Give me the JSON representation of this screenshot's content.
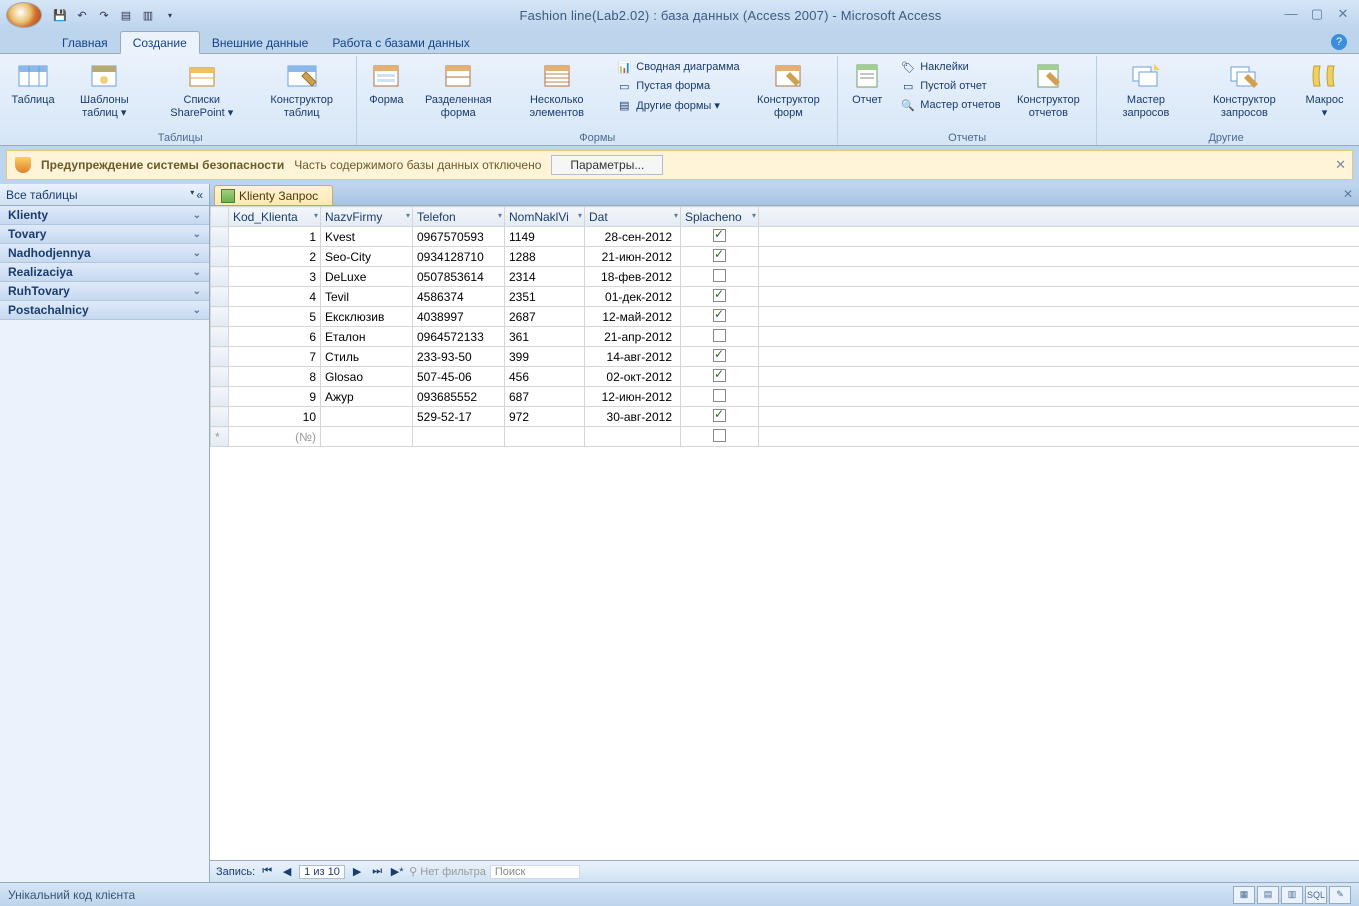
{
  "title": "Fashion line(Lab2.02) : база данных (Access 2007) - Microsoft Access",
  "tabs": [
    "Главная",
    "Создание",
    "Внешние данные",
    "Работа с базами данных"
  ],
  "active_tab": 1,
  "ribbon": {
    "groups": [
      {
        "label": "Таблицы",
        "buttons": [
          "Таблица",
          "Шаблоны таблиц ▾",
          "Списки SharePoint ▾",
          "Конструктор таблиц"
        ]
      },
      {
        "label": "Формы",
        "big": [
          "Форма",
          "Разделенная форма",
          "Несколько элементов"
        ],
        "small": [
          "Сводная диаграмма",
          "Пустая форма",
          "Другие формы ▾"
        ],
        "tail": [
          "Конструктор форм"
        ]
      },
      {
        "label": "Отчеты",
        "big": [
          "Отчет"
        ],
        "small": [
          "Наклейки",
          "Пустой отчет",
          "Мастер отчетов"
        ],
        "tail": [
          "Конструктор отчетов"
        ]
      },
      {
        "label": "Другие",
        "buttons": [
          "Мастер запросов",
          "Конструктор запросов",
          "Макрос ▾"
        ]
      }
    ]
  },
  "security": {
    "heading": "Предупреждение системы безопасности",
    "msg": "Часть содержимого базы данных отключено",
    "btn": "Параметры..."
  },
  "nav": {
    "header": "Все таблицы",
    "items": [
      "Klienty",
      "Tovary",
      "Nadhodjennya",
      "Realizaciya",
      "RuhTovary",
      "Postachalnicy"
    ]
  },
  "object_tab": "Klienty Запрос",
  "columns": [
    "Kod_Klienta",
    "NazvFirmy",
    "Telefon",
    "NomNaklVi",
    "Dat",
    "Splacheno"
  ],
  "rows": [
    {
      "k": "1",
      "f": "Kvest",
      "t": "0967570593",
      "n": "1149",
      "d": "28-сен-2012",
      "s": true
    },
    {
      "k": "2",
      "f": "Seo-City",
      "t": "0934128710",
      "n": "1288",
      "d": "21-июн-2012",
      "s": true
    },
    {
      "k": "3",
      "f": "DeLuxe",
      "t": "0507853614",
      "n": "2314",
      "d": "18-фев-2012",
      "s": false
    },
    {
      "k": "4",
      "f": "Tevil",
      "t": "4586374",
      "n": "2351",
      "d": "01-дек-2012",
      "s": true
    },
    {
      "k": "5",
      "f": "Ексклюзив",
      "t": "4038997",
      "n": "2687",
      "d": "12-май-2012",
      "s": true
    },
    {
      "k": "6",
      "f": "Еталон",
      "t": "0964572133",
      "n": "361",
      "d": "21-апр-2012",
      "s": false
    },
    {
      "k": "7",
      "f": "Стиль",
      "t": "233-93-50",
      "n": "399",
      "d": "14-авг-2012",
      "s": true
    },
    {
      "k": "8",
      "f": "Glosao",
      "t": "507-45-06",
      "n": "456",
      "d": "02-окт-2012",
      "s": true
    },
    {
      "k": "9",
      "f": "Ажур",
      "t": "093685552",
      "n": "687",
      "d": "12-июн-2012",
      "s": false
    },
    {
      "k": "10",
      "f": "",
      "t": "529-52-17",
      "n": "972",
      "d": "30-авг-2012",
      "s": true
    }
  ],
  "newrow_placeholder": "(№)",
  "recnav": {
    "label": "Запись:",
    "pos": "1 из 10",
    "nofilter": "Нет фильтра",
    "search": "Поиск"
  },
  "status": "Унікальний код клієнта"
}
